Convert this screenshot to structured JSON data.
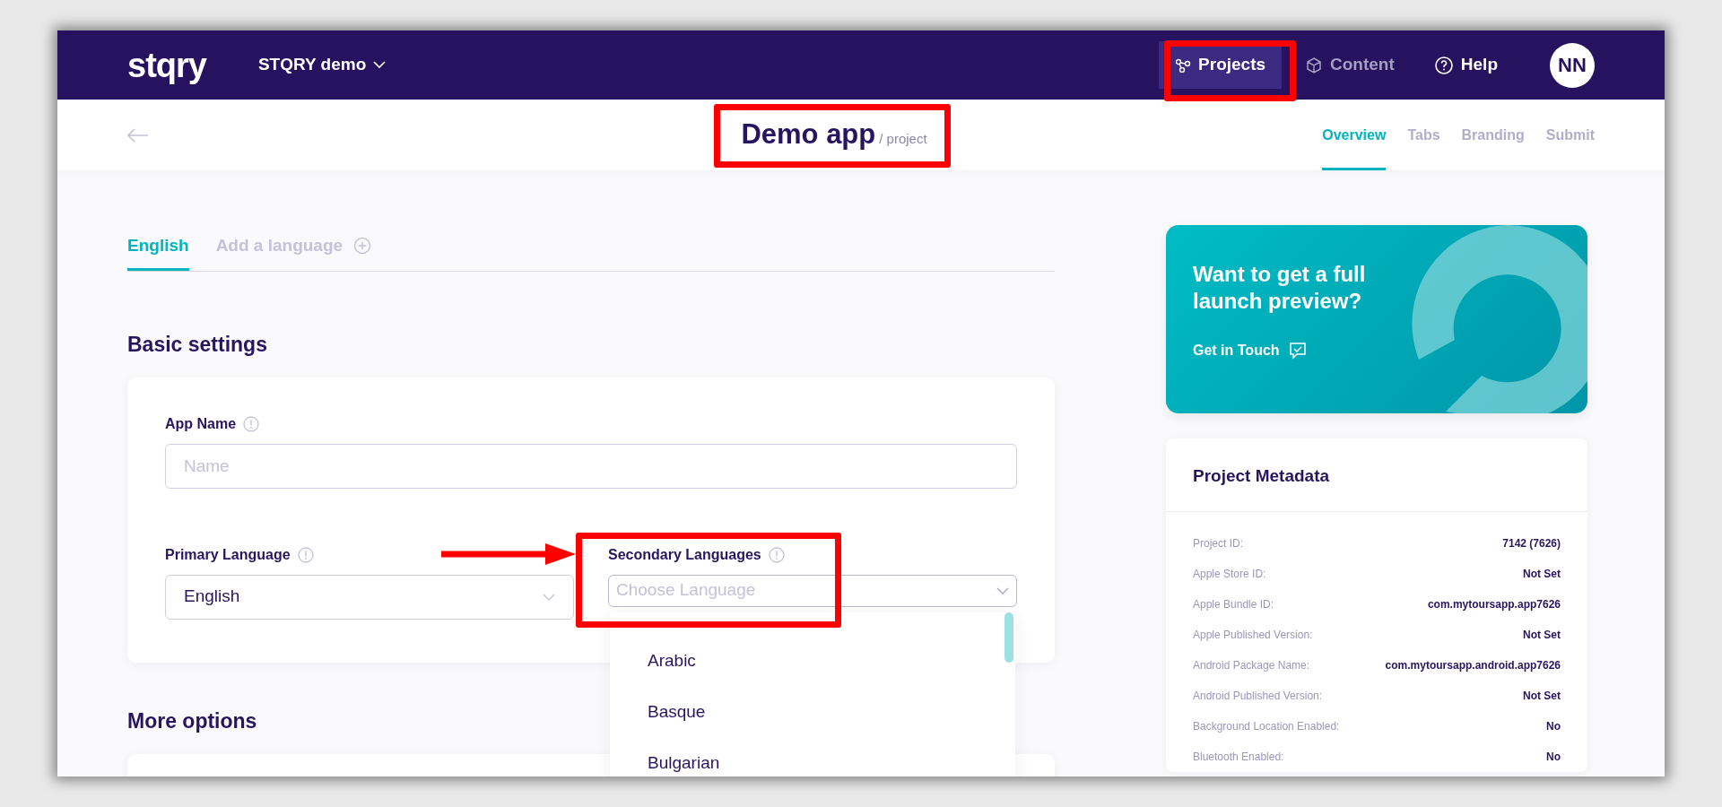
{
  "header": {
    "logo": "stqry",
    "workspace": "STQRY demo",
    "avatar": "NN",
    "nav": [
      {
        "label": "Projects",
        "kind": "projects",
        "selected": true
      },
      {
        "label": "Content",
        "kind": "content",
        "selected": false
      },
      {
        "label": "Help",
        "kind": "help",
        "selected": false
      }
    ]
  },
  "subheader": {
    "title": "Demo app",
    "subtitle": "/ project",
    "tabs": [
      {
        "label": "Overview",
        "selected": true
      },
      {
        "label": "Tabs",
        "selected": false
      },
      {
        "label": "Branding",
        "selected": false
      },
      {
        "label": "Submit",
        "selected": false
      }
    ]
  },
  "language_tabs": [
    {
      "label": "English",
      "kind": "language",
      "selected": true
    },
    {
      "label": "Add a language",
      "kind": "add",
      "selected": false
    }
  ],
  "basic_settings": {
    "title": "Basic settings",
    "app_name": {
      "label": "App Name",
      "placeholder": "Name"
    },
    "primary_language": {
      "label": "Primary Language",
      "value": "English"
    },
    "secondary_languages": {
      "label": "Secondary Languages",
      "placeholder": "Choose Language",
      "expanded": true,
      "options": [
        "Arabic",
        "Basque",
        "Bulgarian"
      ]
    }
  },
  "more_options": {
    "title": "More options"
  },
  "promo": {
    "title": "Want to get a full launch preview?",
    "link": "Get in Touch"
  },
  "metadata": {
    "title": "Project Metadata",
    "rows": [
      {
        "label": "Project ID:",
        "value": "7142 (7626)"
      },
      {
        "label": "Apple Store ID:",
        "value": "Not Set"
      },
      {
        "label": "Apple Bundle ID:",
        "value": "com.mytoursapp.app7626"
      },
      {
        "label": "Apple Published Version:",
        "value": "Not Set"
      },
      {
        "label": "Android Package Name:",
        "value": "com.mytoursapp.android.app7626"
      },
      {
        "label": "Android Published Version:",
        "value": "Not Set"
      },
      {
        "label": "Background Location Enabled:",
        "value": "No"
      },
      {
        "label": "Bluetooth Enabled:",
        "value": "No"
      }
    ]
  }
}
